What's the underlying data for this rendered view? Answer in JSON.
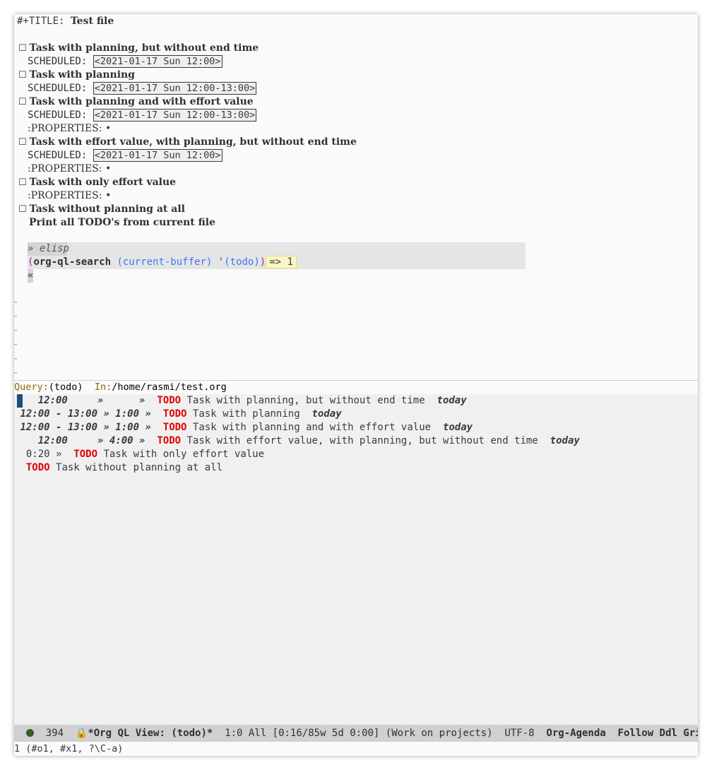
{
  "org": {
    "title_keyword": "#+TITLE:",
    "title": "Test file",
    "checkbox": "☐",
    "scheduled_label": "SCHEDULED:",
    "properties_label": ":PROPERTIES:",
    "properties_marker": "•",
    "headings": [
      {
        "title": "Task with planning, but without end time",
        "scheduled": "<2021-01-17 Sun 12:00>"
      },
      {
        "title": "Task with planning",
        "scheduled": "<2021-01-17 Sun 12:00-13:00>"
      },
      {
        "title": "Task with planning and with effort value",
        "scheduled": "<2021-01-17 Sun 12:00-13:00>"
      },
      {
        "title": "Task with effort value, with planning, but without end time",
        "scheduled": "<2021-01-17 Sun 12:00>"
      },
      {
        "title": "Task with only effort value"
      },
      {
        "title": "Task without planning at all"
      }
    ],
    "body_text": "Print all TODO's from current file",
    "src_header": "» elisp",
    "src_open_paren": "(",
    "src_fn": "org-ql-search",
    "src_arg1": "(current-buffer)",
    "src_quote": "'",
    "src_arg2": "(todo)",
    "src_close_paren": ")",
    "src_result": "=> 1",
    "src_end": "«",
    "fringe_tilde": "~"
  },
  "query_line": {
    "query_label": "Query:",
    "query_value": "(todo)",
    "in_label": "In:",
    "in_value": "/home/rasmi/test.org"
  },
  "agenda": {
    "todo_keyword": "TODO",
    "today_label": "today",
    "rows": [
      {
        "time": "12:00",
        "effort": "»",
        "sep": "»",
        "text": "Task with planning, but without end time",
        "today": true
      },
      {
        "time": "12:00 - 13:00",
        "effort": "» 1:00",
        "sep": "»",
        "text": "Task with planning",
        "today": true
      },
      {
        "time": "12:00 - 13:00",
        "effort": "» 1:00",
        "sep": "»",
        "text": "Task with planning and with effort value",
        "today": true
      },
      {
        "time": "12:00",
        "effort": "» 4:00",
        "sep": "»",
        "text": "Task with effort value, with planning, but without end time",
        "today": true
      },
      {
        "prefix": "0:20 »",
        "text": "Task with only effort value"
      },
      {
        "text": "Task without planning at all"
      }
    ]
  },
  "modeline": {
    "line_number": "394",
    "buffer_name": "*Org QL View: (todo)*",
    "position": "1:0 All",
    "clock": "[0:16/85w 5d 0:00] (Work on projects)",
    "encoding": "UTF-8",
    "mode": "Org-Agenda",
    "minor_modes": "Follow Ddl Grid Hab"
  },
  "echo": "1 (#o1, #x1, ?\\C-a)",
  "colors": {
    "todo": "#e00000",
    "cursor": "#1d4f7a",
    "modeline_bg": "#d0d0d0",
    "agenda_bg": "#f0f0f0",
    "query_label": "#986801"
  }
}
